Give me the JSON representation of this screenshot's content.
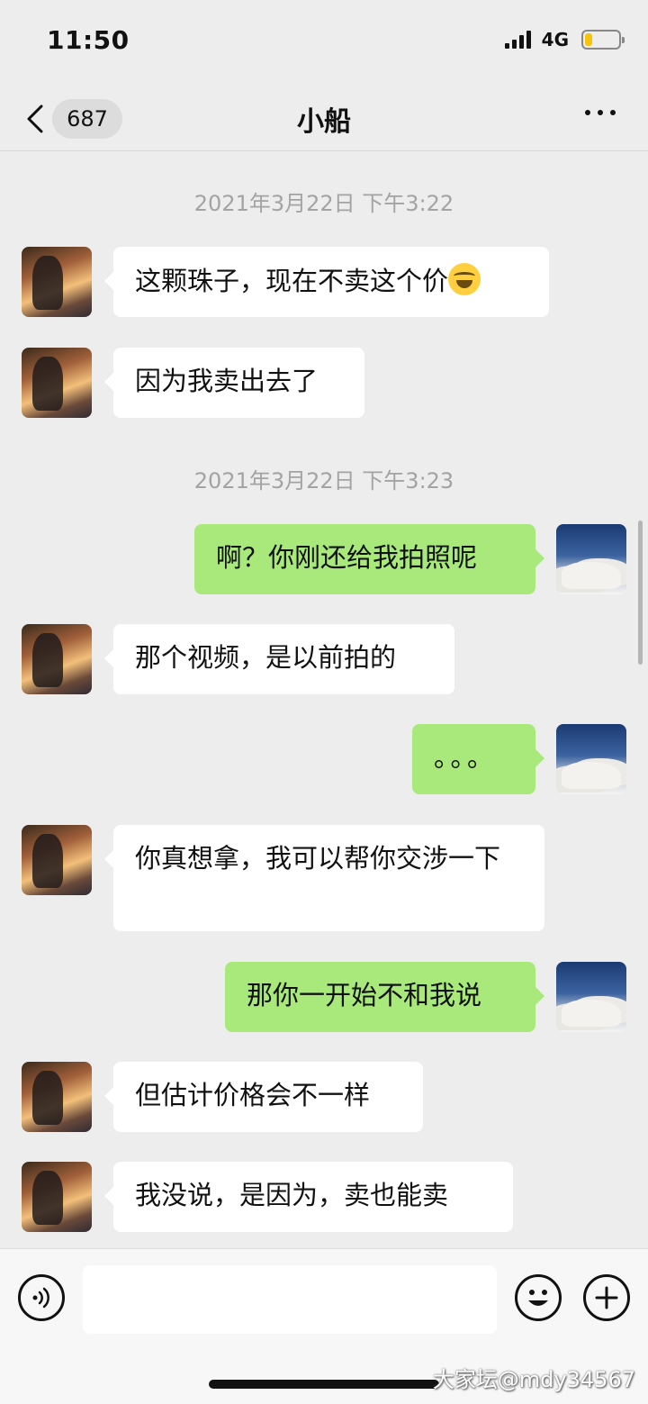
{
  "status_bar": {
    "time": "11:50",
    "network": "4G",
    "battery_level": 0.22
  },
  "nav": {
    "unread_count": "687",
    "title": "小船"
  },
  "chat": {
    "timestamps": [
      "2021年3月22日 下午3:22",
      "2021年3月22日 下午3:23"
    ],
    "messages": [
      {
        "sender": "other",
        "text": "这颗珠子，现在不卖这个价",
        "emoji": "laughing-with-tears"
      },
      {
        "sender": "other",
        "text": "因为我卖出去了"
      },
      {
        "sender": "self",
        "text": "啊？你刚还给我拍照呢"
      },
      {
        "sender": "other",
        "text": "那个视频，是以前拍的"
      },
      {
        "sender": "self",
        "text": "。。。"
      },
      {
        "sender": "other",
        "text": "你真想拿，我可以帮你交涉一下"
      },
      {
        "sender": "self",
        "text": "那你一开始不和我说"
      },
      {
        "sender": "other",
        "text": "但估计价格会不一样"
      },
      {
        "sender": "other",
        "text": "我没说，是因为，卖也能卖"
      }
    ]
  },
  "input": {
    "placeholder": ""
  },
  "watermark": "大家坛@mdy34567",
  "colors": {
    "self_bubble": "#a9e97b",
    "other_bubble": "#ffffff",
    "background": "#ededed"
  }
}
